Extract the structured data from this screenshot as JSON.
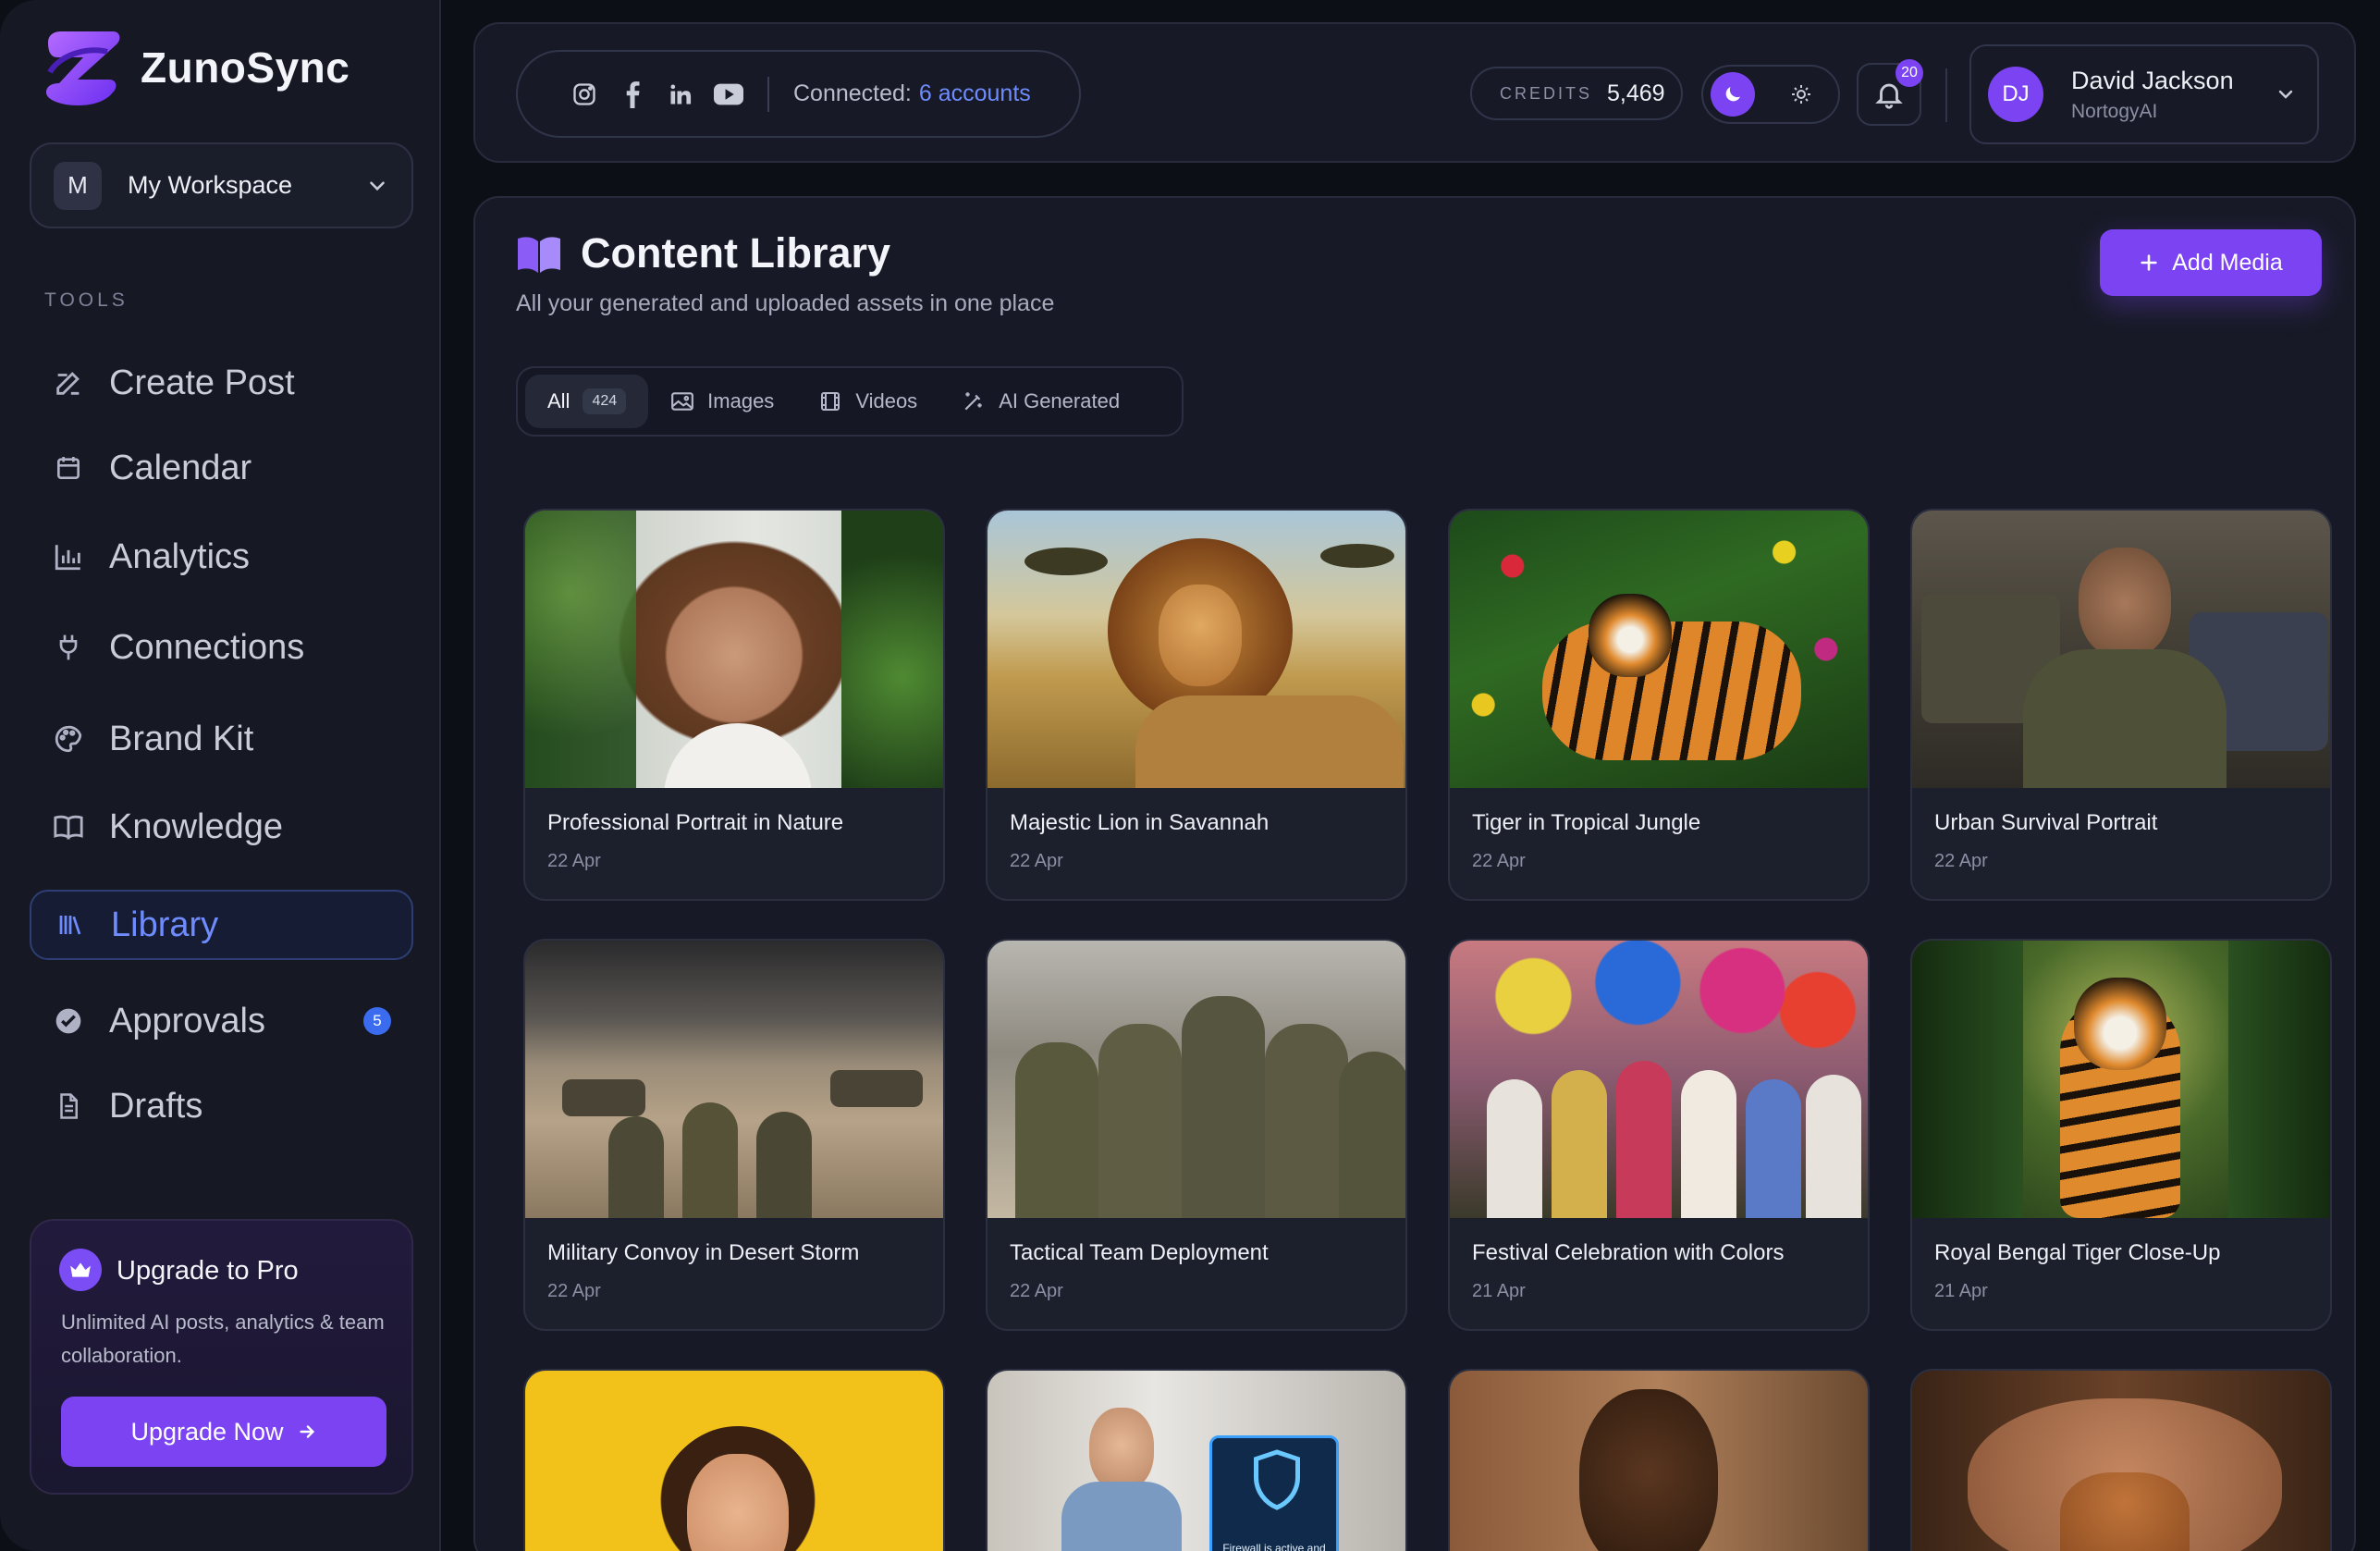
{
  "brand": {
    "name": "ZunoSync"
  },
  "workspace": {
    "initial": "M",
    "name": "My Workspace"
  },
  "sidebar": {
    "section_label": "TOOLS",
    "items": [
      {
        "label": "Create Post",
        "icon": "edit-icon"
      },
      {
        "label": "Calendar",
        "icon": "calendar-icon"
      },
      {
        "label": "Analytics",
        "icon": "bar-chart-icon"
      },
      {
        "label": "Connections",
        "icon": "plug-icon"
      },
      {
        "label": "Brand Kit",
        "icon": "palette-icon"
      },
      {
        "label": "Knowledge",
        "icon": "book-icon"
      },
      {
        "label": "Library",
        "icon": "library-icon",
        "active": true
      },
      {
        "label": "Approvals",
        "icon": "check-circle-icon",
        "badge": "5"
      },
      {
        "label": "Drafts",
        "icon": "document-icon"
      }
    ]
  },
  "upgrade": {
    "title": "Upgrade to Pro",
    "description": "Unlimited AI posts, analytics & team collaboration.",
    "button_label": "Upgrade Now"
  },
  "topbar": {
    "connected_label": "Connected:",
    "connected_accounts": "6 accounts",
    "credits_label": "CREDITS",
    "credits_value": "5,469",
    "notifications_count": "20",
    "user": {
      "initials": "DJ",
      "name": "David Jackson",
      "org": "NortogyAI"
    }
  },
  "library": {
    "title": "Content Library",
    "subtitle": "All your generated and uploaded assets in one place",
    "add_label": "Add Media",
    "filters": [
      {
        "label": "All",
        "count": "424",
        "active": true
      },
      {
        "label": "Images",
        "icon": "image-icon"
      },
      {
        "label": "Videos",
        "icon": "video-icon"
      },
      {
        "label": "AI Generated",
        "icon": "magic-wand-icon"
      }
    ],
    "cards": [
      {
        "title": "Professional Portrait in Nature",
        "date": "22 Apr"
      },
      {
        "title": "Majestic Lion in Savannah",
        "date": "22 Apr"
      },
      {
        "title": "Tiger in Tropical Jungle",
        "date": "22 Apr"
      },
      {
        "title": "Urban Survival Portrait",
        "date": "22 Apr"
      },
      {
        "title": "Military Convoy in Desert Storm",
        "date": "22 Apr"
      },
      {
        "title": "Tactical Team Deployment",
        "date": "22 Apr"
      },
      {
        "title": "Festival Celebration with Colors",
        "date": "21 Apr"
      },
      {
        "title": "Royal Bengal Tiger Close-Up",
        "date": "21 Apr"
      }
    ],
    "partial_overlay_text": "Firewall is active and the system is secure"
  },
  "colors": {
    "accent": "#7b43f2",
    "link": "#6f8cff",
    "background": "#0d0f17",
    "panel": "#171a26"
  }
}
